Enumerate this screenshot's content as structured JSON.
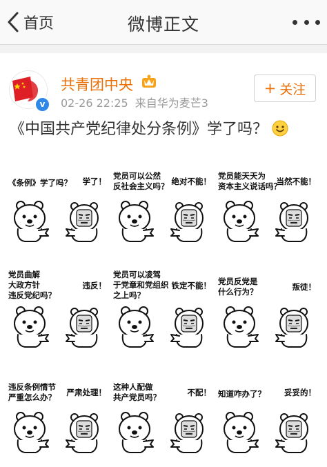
{
  "nav": {
    "back_label": "首页",
    "title": "微博正文"
  },
  "post": {
    "user_name": "共青团中央",
    "date": "02-26 22:25",
    "source": "来自华为麦芒3",
    "follow_label": "关注",
    "text": "《中国共产党纪律处分条例》学了吗？",
    "emoji_name": "smile-emoji"
  },
  "images": [
    {
      "question": [
        "《条例》学了吗？"
      ],
      "answer": [
        "学了！"
      ]
    },
    {
      "question": [
        "党员可以公然",
        "反社会主义吗？"
      ],
      "answer": [
        "绝对不能！"
      ]
    },
    {
      "question": [
        "党员能天天为",
        "资本主义说话吗？"
      ],
      "answer": [
        "当然不能！"
      ]
    },
    {
      "question": [
        "党员曲解",
        "大政方针",
        "违反党纪吗？"
      ],
      "answer": [
        "违反！"
      ]
    },
    {
      "question": [
        "党员可以凌驾",
        "于党章和党组织",
        "之上吗？"
      ],
      "answer": [
        "铁定不能！"
      ]
    },
    {
      "question": [
        "党员反党是",
        "什么行为？"
      ],
      "answer": [
        "叛徒！"
      ]
    },
    {
      "question": [
        "违反条例情节",
        "严重怎么办？"
      ],
      "answer": [
        "严肃处理！"
      ]
    },
    {
      "question": [
        "这种人配做",
        "共产党员吗？"
      ],
      "answer": [
        "不配！"
      ]
    },
    {
      "question": [
        "知道咋办了？"
      ],
      "answer": [
        "妥妥的！"
      ]
    }
  ]
}
